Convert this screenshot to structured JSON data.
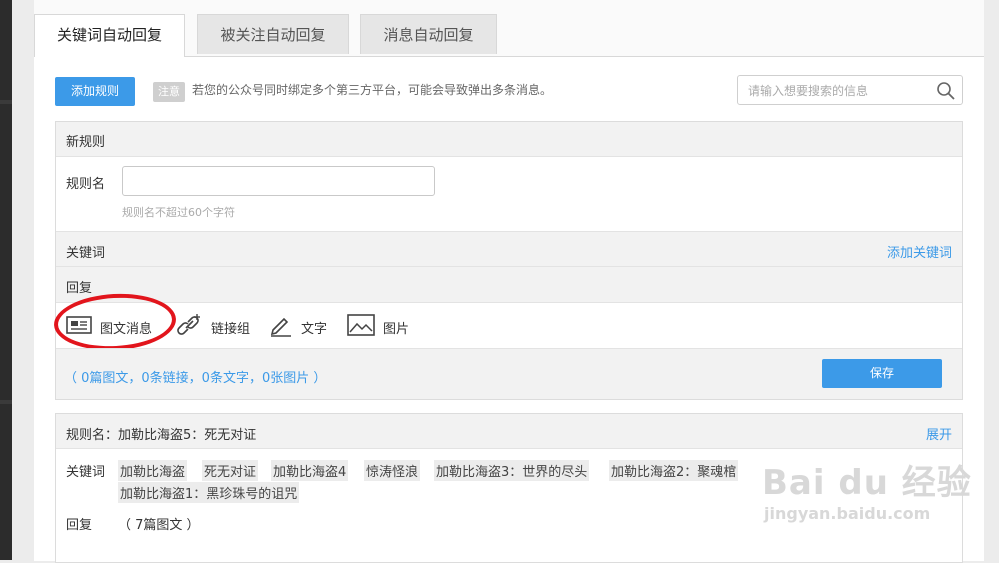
{
  "tabs": [
    {
      "label": "关键词自动回复",
      "active": true
    },
    {
      "label": "被关注自动回复",
      "active": false
    },
    {
      "label": "消息自动回复",
      "active": false
    }
  ],
  "toolbar": {
    "add_rule_label": "添加规则",
    "note_tag": "注意",
    "note_text": "若您的公众号同时绑定多个第三方平台，可能会导致弹出多条消息。",
    "search_placeholder": "请输入想要搜索的信息"
  },
  "new_rule": {
    "header": "新规则",
    "name_label": "规则名",
    "name_value": "",
    "name_hint": "规则名不超过60个字符",
    "keyword_header": "关键词",
    "add_keyword_link": "添加关键词",
    "reply_header": "回复",
    "reply_types": [
      {
        "label": "图文消息",
        "icon": "news-icon"
      },
      {
        "label": "链接组",
        "icon": "link-icon"
      },
      {
        "label": "文字",
        "icon": "pencil-icon"
      },
      {
        "label": "图片",
        "icon": "image-icon"
      }
    ],
    "counts_text": "（ 0篇图文，0条链接，0条文字，0张图片 ）",
    "save_label": "保存"
  },
  "existing_rule": {
    "title": "规则名：加勒比海盗5：死无对证",
    "expand_link": "展开",
    "keyword_label": "关键词",
    "keywords": [
      "加勒比海盗",
      "死无对证",
      "加勒比海盗4",
      "惊涛怪浪",
      "加勒比海盗3：世界的尽头",
      "加勒比海盗2：聚魂棺",
      "加勒比海盗1：黑珍珠号的诅咒"
    ],
    "reply_label": "回复",
    "reply_value": "（ 7篇图文 ）"
  },
  "watermark": {
    "brand": "Bai du 经验",
    "url": "jingyan.baidu.com"
  },
  "colors": {
    "accent": "#3c9ae8",
    "highlight": "#e2151c"
  }
}
